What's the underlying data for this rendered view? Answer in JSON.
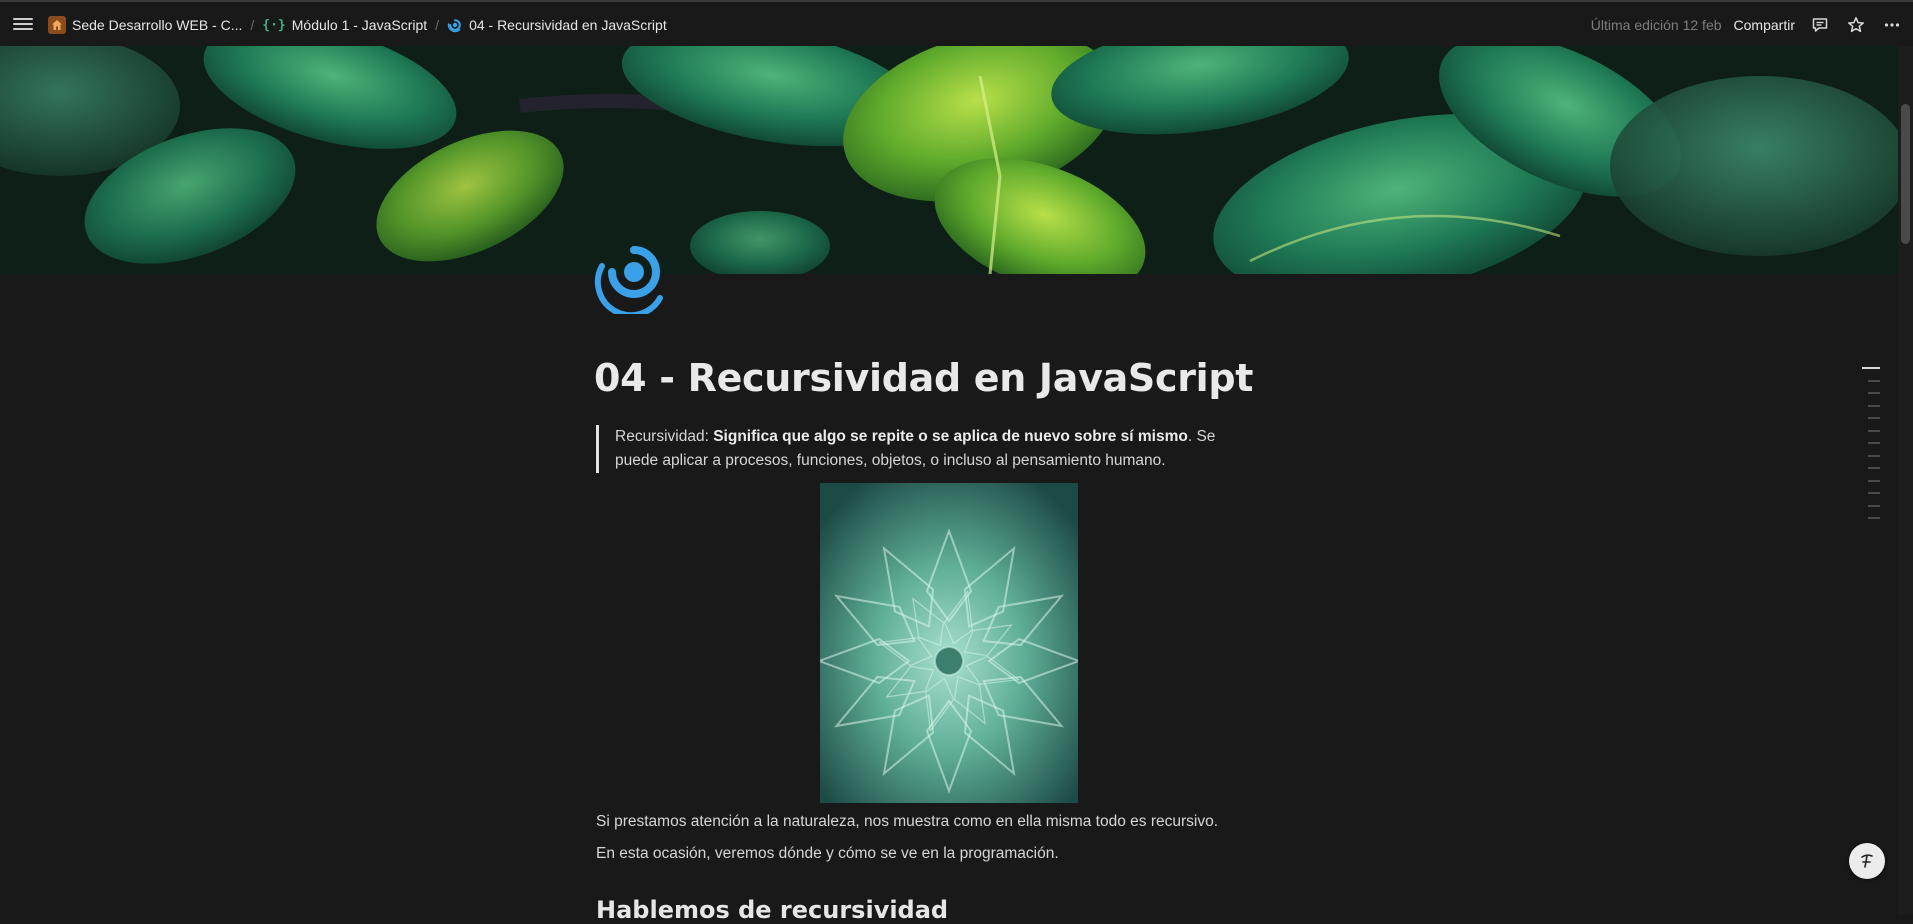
{
  "breadcrumb": {
    "items": [
      {
        "label": "Sede Desarrollo WEB - C...",
        "icon": "home-icon"
      },
      {
        "label": "Módulo 1 - JavaScript",
        "icon": "code-braces-icon"
      },
      {
        "label": "04 - Recursividad en JavaScript",
        "icon": "swirl-icon"
      }
    ],
    "separator": "/"
  },
  "topbar": {
    "last_edit": "Última edición 12 feb",
    "share_label": "Compartir"
  },
  "page": {
    "title": "04 - Recursividad en JavaScript",
    "quote": {
      "prefix": "Recursividad: ",
      "bold": "Significa que algo se repite o se aplica de nuevo sobre sí mismo",
      "suffix": ". Se puede aplicar a procesos, funciones, objetos, o incluso al pensamiento humano."
    },
    "paragraph_1": "Si prestamos atención a la naturaleza, nos muestra como en ella misma todo es recursivo.",
    "paragraph_2": "En esta ocasión, veremos dónde y cómo se ve en la programación.",
    "subheading": "Hablemos de recursividad"
  },
  "colors": {
    "background": "#191919",
    "accent_icon": "#3aa0e8",
    "home_icon_bg": "#8a4b1d",
    "braces_icon": "#3fb37f"
  }
}
